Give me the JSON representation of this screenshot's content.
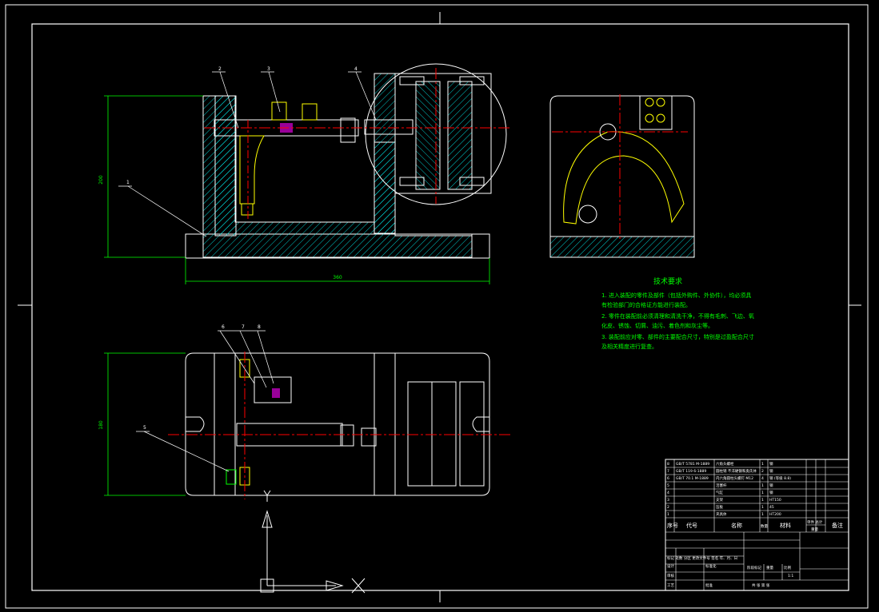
{
  "colors": {
    "background": "#000000",
    "outline": "#ffffff",
    "hatch": "#00ffff",
    "centerline": "#ff0000",
    "dimension": "#00ff00",
    "part": "#ffff00",
    "leader": "#ffffff",
    "highlight": "#ff00ff"
  },
  "balloons": [
    "1",
    "2",
    "3",
    "4",
    "5",
    "6",
    "7",
    "8"
  ],
  "dimensions": {
    "front_height": "200",
    "front_width": "360",
    "top_height": "180"
  },
  "tech_requirements": {
    "title": "技术要求",
    "lines": [
      "1. 进入装配的零件及部件（包括外购件、外协件），均必须具",
      "有检验部门的合格证方能进行装配。",
      "2. 零件在装配前必须清理和清洗干净，不得有毛刺、飞边、氧",
      "化皮、锈蚀、切屑、油污、着色剂和灰尘等。",
      "3. 装配前应对零、部件的主要配合尺寸，特别是过盈配合尺寸",
      "及相关精度进行复查。"
    ]
  },
  "parts_list": [
    {
      "no": "8",
      "code": "GB/T 5781 M-1889",
      "name": "六角头螺栓",
      "qty": "1",
      "material": "钢"
    },
    {
      "no": "7",
      "code": "GB/T 119 6-1889",
      "name": "圆柱销 不淬硬钢和奥氏体",
      "qty": "2",
      "material": "钢"
    },
    {
      "no": "6",
      "code": "GB/T 70.1 M-1889",
      "name": "内六角圆柱头螺钉 M12",
      "qty": "4",
      "material": "钢 (等级 8.8)"
    },
    {
      "no": "5",
      "code": "",
      "name": "活塞杆",
      "qty": "1",
      "material": "钢"
    },
    {
      "no": "4",
      "code": "",
      "name": "气缸",
      "qty": "1",
      "material": "钢"
    },
    {
      "no": "3",
      "code": "",
      "name": "支架",
      "qty": "1",
      "material": "HT150"
    },
    {
      "no": "2",
      "code": "",
      "name": "压板",
      "qty": "1",
      "material": "45"
    },
    {
      "no": "1",
      "code": "",
      "name": "夹具体",
      "qty": "1",
      "material": "HT200"
    }
  ],
  "parts_header": {
    "no": "序号",
    "code": "代号",
    "name": "名称",
    "qty": "数量",
    "material": "材料",
    "unit_weight": "单件 总计",
    "weight": "重量",
    "remark": "备注"
  },
  "title_block": {
    "revision_row": "标记 处数 分区 更改文件号 签名 年、月、日",
    "design": "设计",
    "standardize": "标准化",
    "review": "审核",
    "process": "工艺",
    "approve": "批准",
    "stage_label": "阶段标记",
    "weight_label": "重量",
    "scale_label": "比例",
    "scale_value": "1:1",
    "sheet_label": "共 张 第 张"
  }
}
